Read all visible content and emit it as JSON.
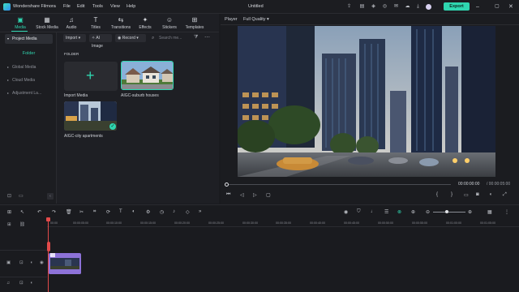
{
  "app": {
    "name": "Wondershare Filmora",
    "doc_title": "Untitled",
    "export_label": "Export"
  },
  "menu": [
    "File",
    "Edit",
    "Tools",
    "View",
    "Help"
  ],
  "tabs": [
    {
      "label": "Media",
      "icon": "media-icon",
      "active": true
    },
    {
      "label": "Stock Media",
      "icon": "stock-media-icon"
    },
    {
      "label": "Audio",
      "icon": "audio-icon"
    },
    {
      "label": "Titles",
      "icon": "titles-icon"
    },
    {
      "label": "Transitions",
      "icon": "transitions-icon"
    },
    {
      "label": "Effects",
      "icon": "effects-icon"
    },
    {
      "label": "Stickers",
      "icon": "stickers-icon"
    },
    {
      "label": "Templates",
      "icon": "templates-icon"
    }
  ],
  "sidebar": {
    "items": [
      "Project Media",
      "Global Media",
      "Cloud Media",
      "Adjustment La..."
    ],
    "folder": "Folder"
  },
  "media_toolbar": {
    "import": "Import",
    "ai_image": "AI Image",
    "record": "Record",
    "search_placeholder": "Search me..."
  },
  "media": {
    "folder_label": "FOLDER",
    "items": [
      "Import Media",
      "AIGC-suburb houses",
      "AIGC-city apartments"
    ]
  },
  "player": {
    "label": "Player",
    "quality": "Full Quality",
    "time_current": "00:00:00:00",
    "time_total": "/ 00:00:05:00"
  },
  "timeline": {
    "ticks": [
      "00:00",
      "00:00:05:00",
      "00:00:10:00",
      "00:00:15:00",
      "00:00:20:00",
      "00:00:25:00",
      "00:00:30:00",
      "00:00:35:00",
      "00:00:40:00",
      "00:00:45:00",
      "00:00:50:00",
      "00:00:55:00",
      "00:01:00:00",
      "00:01:05:00"
    ]
  },
  "colors": {
    "accent": "#2fd6b0",
    "clip": "#8d72d8",
    "playhead": "#e24a4a"
  }
}
